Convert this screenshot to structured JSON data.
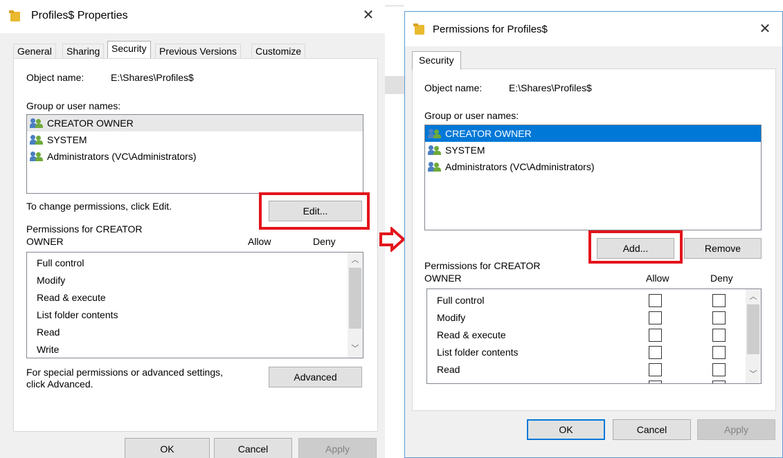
{
  "left": {
    "title": "Profiles$ Properties",
    "tabs": [
      "General",
      "Sharing",
      "Security",
      "Previous Versions",
      "Customize"
    ],
    "object_name_label": "Object name:",
    "object_name_value": "E:\\Shares\\Profiles$",
    "group_label": "Group or user names:",
    "users": [
      "CREATOR OWNER",
      "SYSTEM",
      "Administrators (VC\\Administrators)"
    ],
    "change_hint": "To change permissions, click Edit.",
    "edit_button": "Edit...",
    "perms_for_line1": "Permissions for CREATOR",
    "perms_for_line2": "OWNER",
    "allow_header": "Allow",
    "deny_header": "Deny",
    "permissions": [
      "Full control",
      "Modify",
      "Read & execute",
      "List folder contents",
      "Read",
      "Write"
    ],
    "special_line1": "For special permissions or advanced settings,",
    "special_line2": "click Advanced.",
    "advanced_button": "Advanced",
    "ok_button": "OK",
    "cancel_button": "Cancel",
    "apply_button": "Apply"
  },
  "right": {
    "title": "Permissions for Profiles$",
    "tab": "Security",
    "object_name_label": "Object name:",
    "object_name_value": "E:\\Shares\\Profiles$",
    "group_label": "Group or user names:",
    "users": [
      "CREATOR OWNER",
      "SYSTEM",
      "Administrators (VC\\Administrators)"
    ],
    "add_button": "Add...",
    "remove_button": "Remove",
    "perms_for_line1": "Permissions for CREATOR",
    "perms_for_line2": "OWNER",
    "allow_header": "Allow",
    "deny_header": "Deny",
    "permissions": [
      "Full control",
      "Modify",
      "Read & execute",
      "List folder contents",
      "Read"
    ],
    "ok_button": "OK",
    "cancel_button": "Cancel",
    "apply_button": "Apply"
  },
  "colors": {
    "highlight_red": "#e3141c",
    "selection_blue": "#0078d7",
    "folder": "#e9b92f"
  },
  "icons": {
    "folder": "folder-icon",
    "users": "users-icon",
    "close": "close-icon",
    "arrow": "right-arrow-icon"
  }
}
